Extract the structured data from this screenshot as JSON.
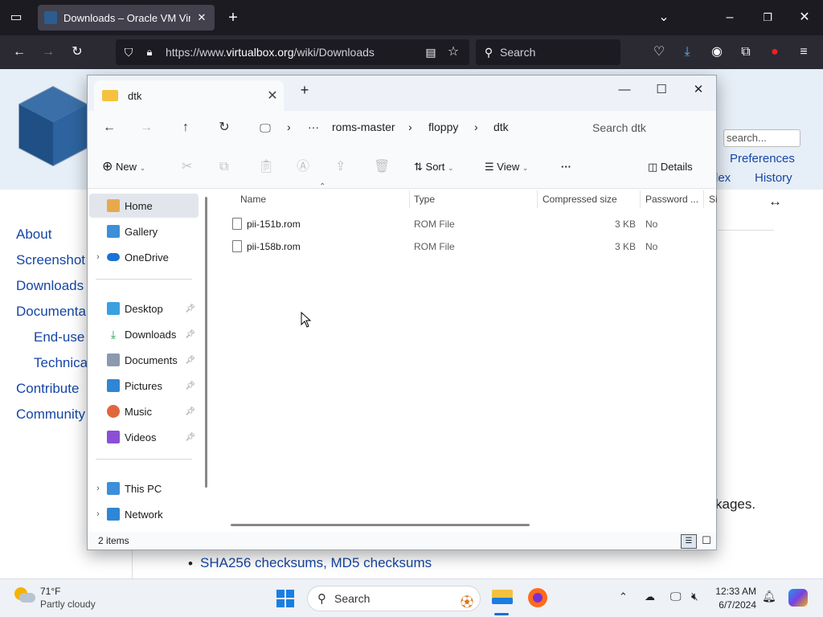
{
  "browser": {
    "tab_title": "Downloads – Oracle VM Virtual",
    "tab_close": "✕",
    "new_tab": "+",
    "url_scheme": "https://www.",
    "url_host": "virtualbox.org",
    "url_path": "/wiki/Downloads",
    "search_placeholder": "Search"
  },
  "webpage": {
    "search_value": "search...",
    "top_links": [
      "Preferences",
      "History"
    ],
    "top_partial": "lex",
    "resize_arrow": "↔",
    "side_links": [
      "About",
      "Screenshot",
      "Downloads",
      "Documenta",
      "End-use",
      "Technica",
      "Contribute",
      "Community"
    ],
    "bullet_text": "SHA256 checksums, MD5 checksums",
    "right_text": "kages."
  },
  "explorer": {
    "tab_title": "dtk",
    "add_tab": "+",
    "breadcrumbs": [
      "roms-master",
      "floppy",
      "dtk"
    ],
    "ellipsis": "···",
    "search_placeholder": "Search dtk",
    "toolbar": {
      "new_label": "New",
      "sort_label": "Sort",
      "view_label": "View",
      "more_label": "···",
      "details_label": "Details"
    },
    "nav": {
      "home": "Home",
      "gallery": "Gallery",
      "onedrive": "OneDrive",
      "desktop": "Desktop",
      "downloads": "Downloads",
      "documents": "Documents",
      "pictures": "Pictures",
      "music": "Music",
      "videos": "Videos",
      "thispc": "This PC",
      "network": "Network"
    },
    "columns": {
      "name": "Name",
      "type": "Type",
      "compressed": "Compressed size",
      "password": "Password ...",
      "size": "Si"
    },
    "files": [
      {
        "name": "pii-151b.rom",
        "type": "ROM File",
        "compressed": "3 KB",
        "password": "No"
      },
      {
        "name": "pii-158b.rom",
        "type": "ROM File",
        "compressed": "3 KB",
        "password": "No"
      }
    ],
    "status": "2 items"
  },
  "taskbar": {
    "temp": "71°F",
    "weather": "Partly cloudy",
    "search_label": "Search",
    "time": "12:33 AM",
    "date": "6/7/2024"
  }
}
